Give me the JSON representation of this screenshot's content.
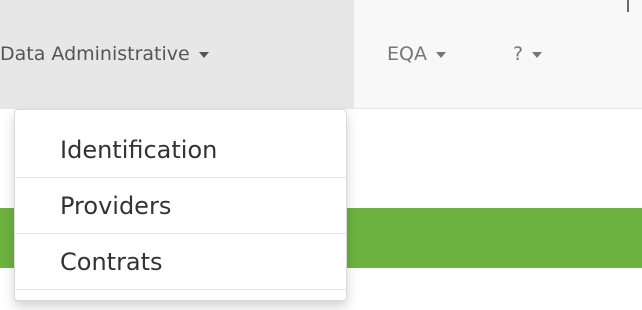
{
  "navbar": {
    "items": [
      {
        "label": "Data Administrative"
      },
      {
        "label": "EQA"
      },
      {
        "label": "?"
      }
    ]
  },
  "dropdown": {
    "items": [
      {
        "label": "Identification"
      },
      {
        "label": "Providers"
      },
      {
        "label": "Contrats"
      }
    ]
  },
  "colors": {
    "navbar_bg": "#f8f8f8",
    "active_tab_bg": "#e7e7e7",
    "green_bar": "#6db33f"
  }
}
